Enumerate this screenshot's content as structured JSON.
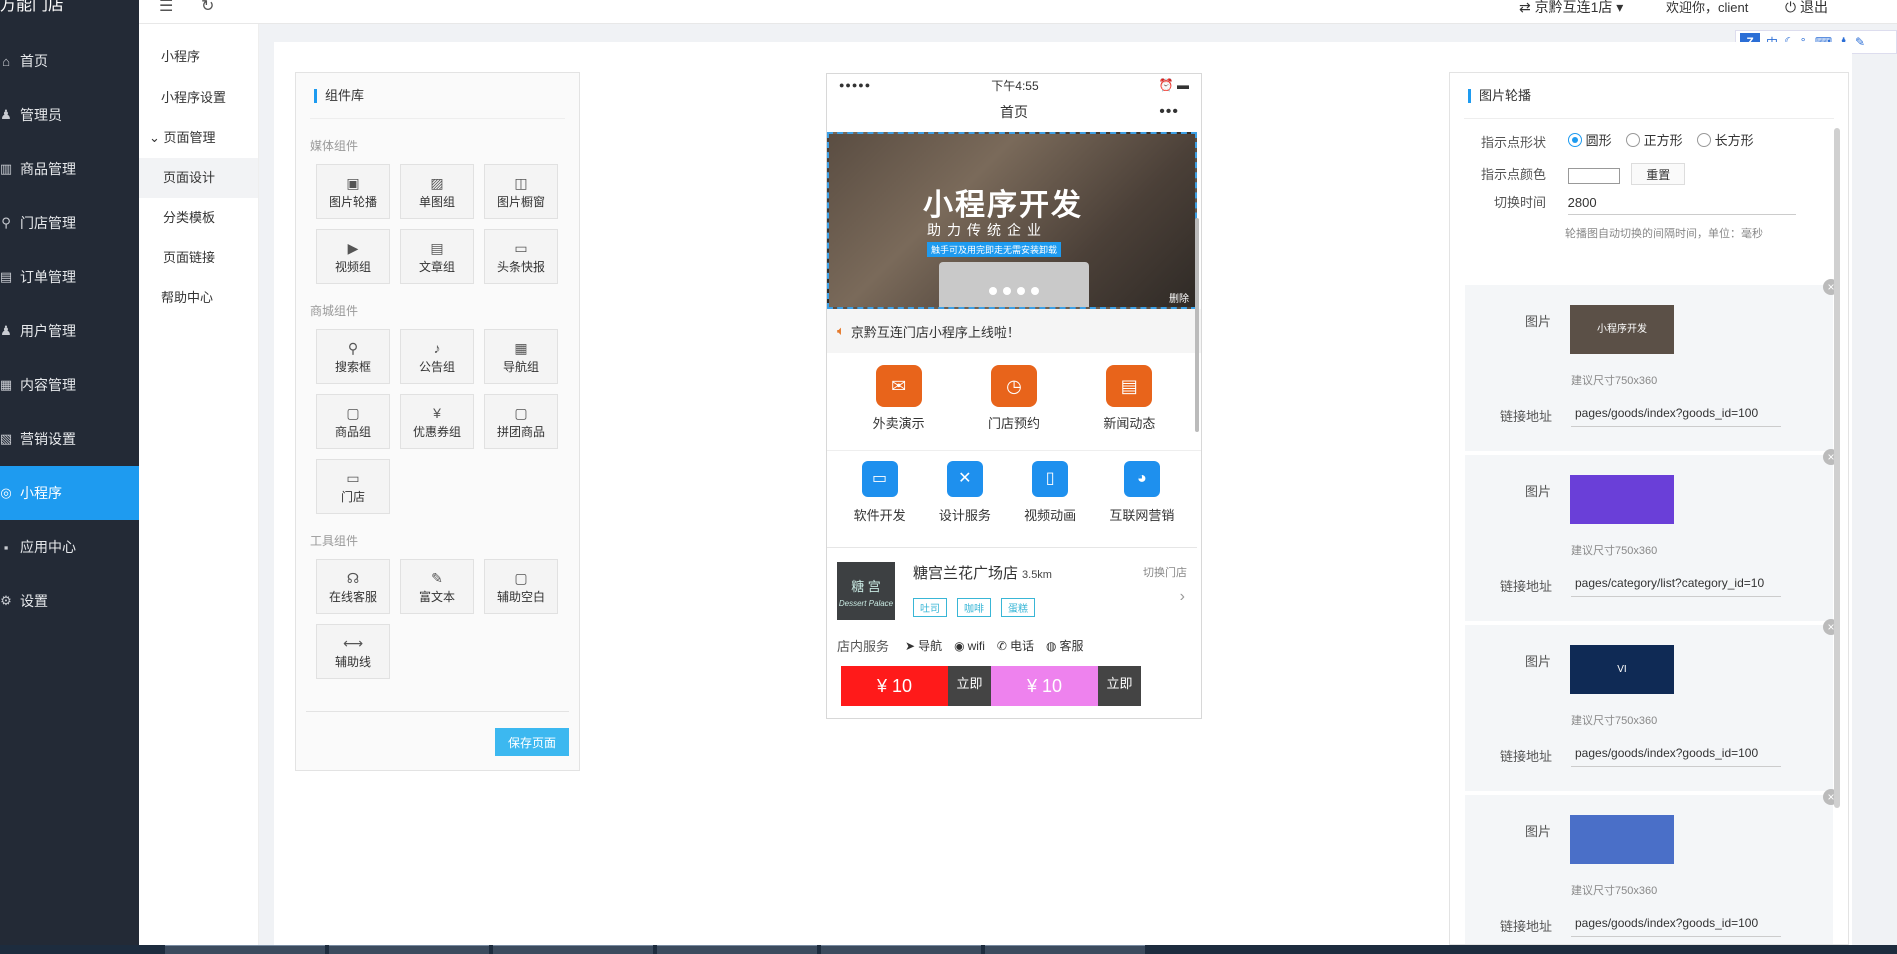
{
  "app": {
    "logo_text": "万能门店"
  },
  "sidebar": {
    "items": [
      {
        "label": "首页",
        "icon": "home-icon",
        "glyph": "⌂"
      },
      {
        "label": "管理员",
        "icon": "admin-icon",
        "glyph": "♟"
      },
      {
        "label": "商品管理",
        "icon": "goods-icon",
        "glyph": "▥"
      },
      {
        "label": "门店管理",
        "icon": "store-pin-icon",
        "glyph": "⚲"
      },
      {
        "label": "订单管理",
        "icon": "order-icon",
        "glyph": "▤"
      },
      {
        "label": "用户管理",
        "icon": "user-icon",
        "glyph": "♟"
      },
      {
        "label": "内容管理",
        "icon": "content-icon",
        "glyph": "▦"
      },
      {
        "label": "营销设置",
        "icon": "marketing-icon",
        "glyph": "▧"
      },
      {
        "label": "小程序",
        "icon": "miniapp-icon",
        "glyph": "◎",
        "active": true
      },
      {
        "label": "应用中心",
        "icon": "apps-icon",
        "glyph": "▪"
      },
      {
        "label": "设置",
        "icon": "gear-icon",
        "glyph": "⚙"
      }
    ]
  },
  "subnav": {
    "items": [
      {
        "label": "小程序"
      },
      {
        "label": "小程序设置"
      },
      {
        "label": "页面管理"
      },
      {
        "label": "页面设计"
      },
      {
        "label": "分类模板"
      },
      {
        "label": "页面链接"
      },
      {
        "label": "帮助中心"
      }
    ]
  },
  "topbar": {
    "store_switch": "京黔互连1店",
    "welcome": "欢迎你，client",
    "logout": "退出"
  },
  "ime": {
    "z": "Z",
    "lang": "中"
  },
  "library": {
    "title": "组件库",
    "groups": [
      {
        "title": "媒体组件",
        "items": [
          {
            "label": "图片轮播",
            "icon": "carousel-icon",
            "glyph": "▣"
          },
          {
            "label": "单图组",
            "icon": "image-icon",
            "glyph": "▨"
          },
          {
            "label": "图片橱窗",
            "icon": "window-icon",
            "glyph": "◫"
          },
          {
            "label": "视频组",
            "icon": "video-icon",
            "glyph": "▶"
          },
          {
            "label": "文章组",
            "icon": "article-icon",
            "glyph": "▤"
          },
          {
            "label": "头条快报",
            "icon": "headline-icon",
            "glyph": "▭"
          }
        ]
      },
      {
        "title": "商城组件",
        "items": [
          {
            "label": "搜索框",
            "icon": "search-icon",
            "glyph": "⚲"
          },
          {
            "label": "公告组",
            "icon": "speaker-icon",
            "glyph": "♪"
          },
          {
            "label": "导航组",
            "icon": "grid-icon",
            "glyph": "▦"
          },
          {
            "label": "商品组",
            "icon": "bag-icon",
            "glyph": "▢"
          },
          {
            "label": "优惠券组",
            "icon": "coupon-icon",
            "glyph": "¥"
          },
          {
            "label": "拼团商品",
            "icon": "group-buy-icon",
            "glyph": "▢"
          },
          {
            "label": "门店",
            "icon": "shop-icon",
            "glyph": "▭"
          }
        ]
      },
      {
        "title": "工具组件",
        "items": [
          {
            "label": "在线客服",
            "icon": "headset-icon",
            "glyph": "☊"
          },
          {
            "label": "富文本",
            "icon": "richtext-icon",
            "glyph": "✎"
          },
          {
            "label": "辅助空白",
            "icon": "blank-icon",
            "glyph": "▢"
          },
          {
            "label": "辅助线",
            "icon": "line-icon",
            "glyph": "⟷"
          }
        ]
      }
    ],
    "save_label": "保存页面"
  },
  "phone": {
    "status_left": "●●●●●",
    "status_time": "下午4:55",
    "nav_title": "首页",
    "nav_more": "•••",
    "banner": {
      "title": "小程序开发",
      "subtitle": "助力传统企业",
      "tagline": "触手可及用完即走无需安装卸载",
      "delete": "删除"
    },
    "notice": "京黔互连门店小程序上线啦！",
    "icons_orange": [
      {
        "label": "外卖演示",
        "icon": "takeout-icon",
        "glyph": "✉"
      },
      {
        "label": "门店预约",
        "icon": "appointment-icon",
        "glyph": "◷"
      },
      {
        "label": "新闻动态",
        "icon": "news-icon",
        "glyph": "▤"
      }
    ],
    "icons_blue": [
      {
        "label": "软件开发",
        "icon": "monitor-icon",
        "glyph": "▭"
      },
      {
        "label": "设计服务",
        "icon": "design-icon",
        "glyph": "✕"
      },
      {
        "label": "视频动画",
        "icon": "mobile-icon",
        "glyph": "▯"
      },
      {
        "label": "互联网营销",
        "icon": "wechat-icon",
        "glyph": "◕"
      }
    ],
    "store": {
      "logo_text": "糖 宫",
      "logo_sub": "Dessert Palace",
      "name": "糖宫兰花广场店",
      "distance": "3.5km",
      "switch": "切换门店",
      "tags": [
        "吐司",
        "咖啡",
        "蛋糕"
      ],
      "service_label": "店内服务",
      "services": [
        {
          "label": "导航",
          "icon": "navigation-icon",
          "glyph": "➤"
        },
        {
          "label": "wifi",
          "icon": "wifi-icon",
          "glyph": "◉"
        },
        {
          "label": "电话",
          "icon": "phone-icon",
          "glyph": "✆"
        },
        {
          "label": "客服",
          "icon": "chat-icon",
          "glyph": "◍"
        }
      ]
    },
    "coupons": [
      {
        "amount": "¥ 10",
        "action": "立即",
        "color": "#ff1a1a"
      },
      {
        "amount": "¥ 10",
        "action": "立即",
        "color": "#ee82ee"
      }
    ]
  },
  "settings": {
    "title": "图片轮播",
    "dot_shape_label": "指示点形状",
    "dot_shapes": [
      {
        "label": "圆形",
        "checked": true
      },
      {
        "label": "正方形",
        "checked": false
      },
      {
        "label": "长方形",
        "checked": false
      }
    ],
    "dot_color_label": "指示点颜色",
    "reset_label": "重置",
    "interval_label": "切换时间",
    "interval_value": "2800",
    "interval_hint": "轮播图自动切换的间隔时间，单位：毫秒",
    "image_label": "图片",
    "size_hint": "建议尺寸750x360",
    "link_label": "链接地址",
    "slides": [
      {
        "thumb_text": "小程序开发",
        "thumb_color": "#5b5047",
        "link": "pages/goods/index?goods_id=100"
      },
      {
        "thumb_text": "",
        "thumb_color": "#6a3fd8",
        "link": "pages/category/list?category_id=10"
      },
      {
        "thumb_text": "VI",
        "thumb_color": "#0f2a55",
        "link": "pages/goods/index?goods_id=100"
      },
      {
        "thumb_text": "",
        "thumb_color": "#4a6fc8",
        "link": "pages/goods/index?goods_id=100"
      }
    ]
  },
  "colors": {
    "accent": "#1e9bf0",
    "sidebar_bg": "#232a36"
  }
}
